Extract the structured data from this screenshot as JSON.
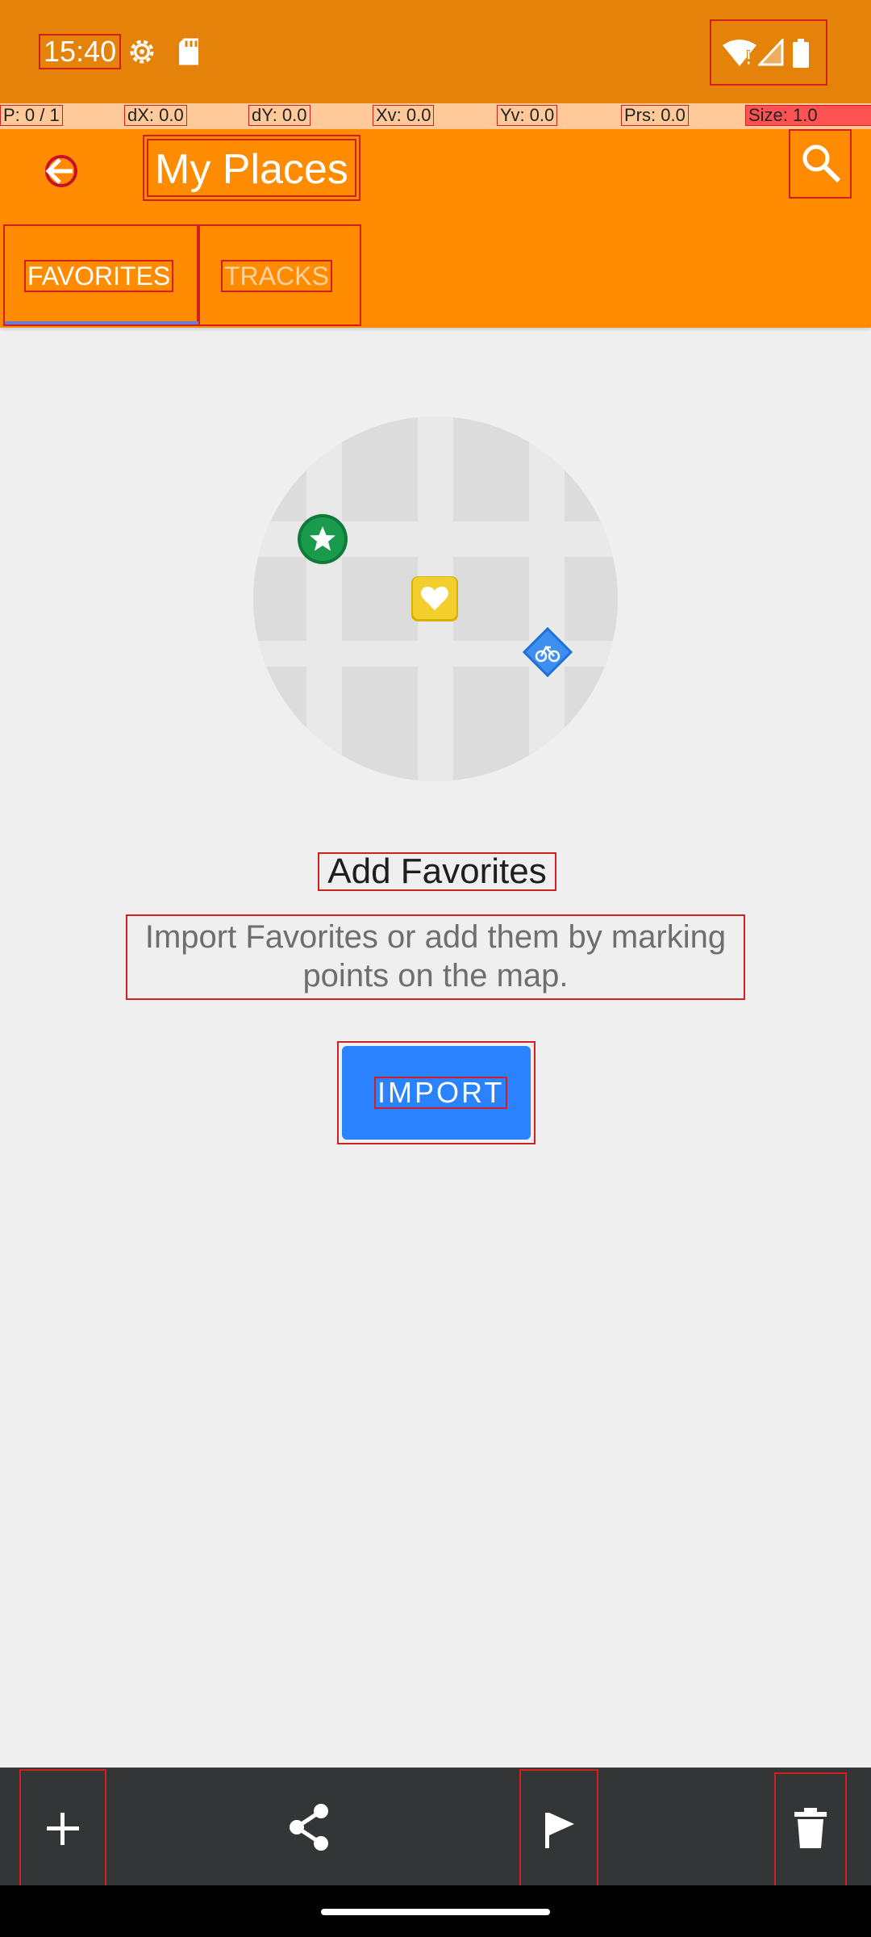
{
  "status_bar": {
    "time": "15:40",
    "icons": [
      "settings-icon",
      "sd-card-icon",
      "wifi-alert-icon",
      "signal-icon",
      "battery-icon"
    ]
  },
  "pointer_location": {
    "p": "P: 0 / 1",
    "dx": "dX: 0.0",
    "dy": "dY: 0.0",
    "xv": "Xv: 0.0",
    "yv": "Yv: 0.0",
    "prs": "Prs: 0.0",
    "size": "Size: 1.0"
  },
  "app_bar": {
    "title": "My Places",
    "back_icon": "back-icon",
    "search_icon": "search-icon"
  },
  "tabs": [
    {
      "label": "FAVORITES",
      "selected": true
    },
    {
      "label": "TRACKS",
      "selected": false
    }
  ],
  "empty_state": {
    "title": "Add Favorites",
    "description": "Import Favorites or add them by marking points on the map.",
    "button_label": "IMPORT"
  },
  "bottom_actions": [
    "add-icon",
    "share-icon",
    "flag-icon",
    "delete-icon"
  ],
  "colors": {
    "status_bar": "#e5820a",
    "app_bar": "#ff8c00",
    "import_button": "#2a82ff",
    "bottom_bar": "#333537"
  }
}
